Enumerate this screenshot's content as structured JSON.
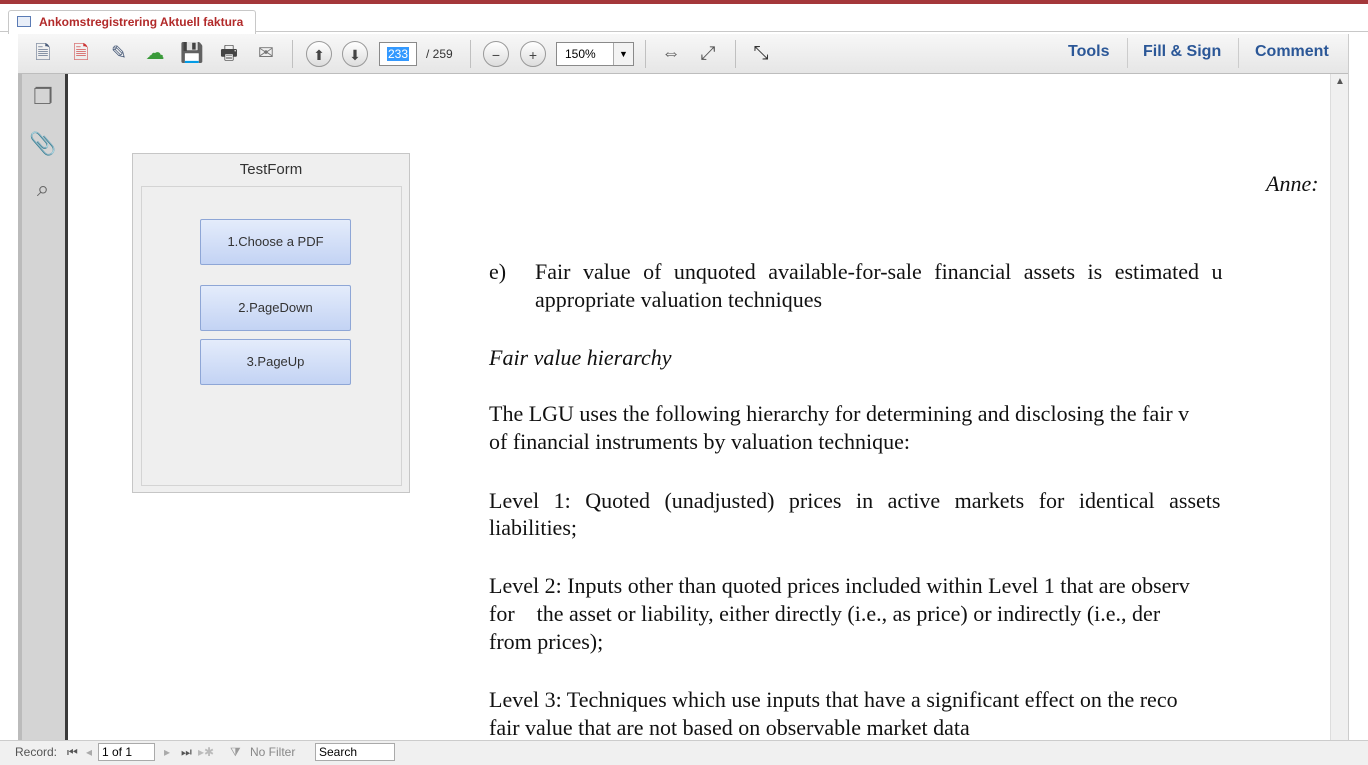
{
  "window": {
    "tab_title": "Ankomstregistrering Aktuell faktura"
  },
  "toolbar": {
    "page_current": "233",
    "page_total": "/ 259",
    "zoom": "150%",
    "tools": "Tools",
    "fill_sign": "Fill & Sign",
    "comment": "Comment"
  },
  "form": {
    "title": "TestForm",
    "buttons": [
      "1.Choose a PDF",
      "2.PageDown",
      "3.PageUp"
    ]
  },
  "document": {
    "annex": "Anne:",
    "item_e_label": "e)",
    "item_e_line1": "Fair value of unquoted available-for-sale financial assets is estimated u",
    "item_e_line2": "appropriate valuation techniques",
    "heading": "Fair value hierarchy",
    "p1_l1": "The LGU uses the following hierarchy for determining and disclosing the fair v",
    "p1_l2": "of financial instruments by valuation technique:",
    "l1_l1": "Level 1: Quoted (unadjusted) prices in active markets for identical assets",
    "l1_l2": "liabilities;",
    "l2_l1": "Level 2: Inputs other than quoted prices included within Level 1 that are observ",
    "l2_l2": "for    the asset or liability, either directly (i.e., as price) or indirectly (i.e., der",
    "l2_l3": "from prices);",
    "l3_l1": "Level 3: Techniques which use inputs that have a significant effect on the reco",
    "l3_l2": "fair value that are not based on observable market data"
  },
  "status": {
    "record_label": "Record:",
    "record_value": "1 of 1",
    "no_filter": "No Filter",
    "search": "Search"
  }
}
